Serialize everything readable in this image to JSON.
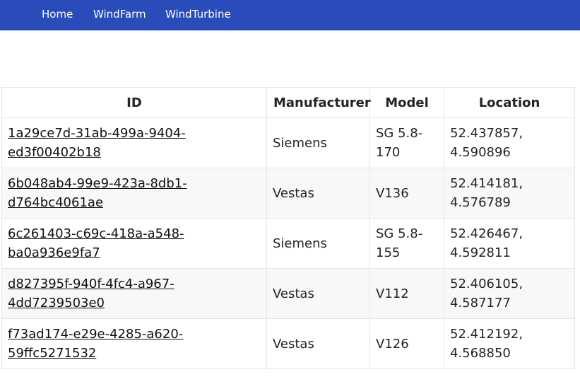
{
  "nav": {
    "items": [
      {
        "label": "Home"
      },
      {
        "label": "WindFarm"
      },
      {
        "label": "WindTurbine"
      }
    ]
  },
  "table": {
    "headers": {
      "id": "ID",
      "manufacturer": "Manufacturer",
      "model": "Model",
      "location": "Location"
    },
    "rows": [
      {
        "id": "1a29ce7d-31ab-499a-9404-ed3f00402b18",
        "manufacturer": "Siemens",
        "model": "SG 5.8-170",
        "location": "52.437857, 4.590896"
      },
      {
        "id": "6b048ab4-99e9-423a-8db1-d764bc4061ae",
        "manufacturer": "Vestas",
        "model": "V136",
        "location": "52.414181, 4.576789"
      },
      {
        "id": "6c261403-c69c-418a-a548-ba0a936e9fa7",
        "manufacturer": "Siemens",
        "model": "SG 5.8-155",
        "location": "52.426467, 4.592811"
      },
      {
        "id": "d827395f-940f-4fc4-a967-4dd7239503e0",
        "manufacturer": "Vestas",
        "model": "V112",
        "location": "52.406105, 4.587177"
      },
      {
        "id": "f73ad174-e29e-4285-a620-59ffc5271532",
        "manufacturer": "Vestas",
        "model": "V126",
        "location": "52.412192, 4.568850"
      }
    ]
  }
}
